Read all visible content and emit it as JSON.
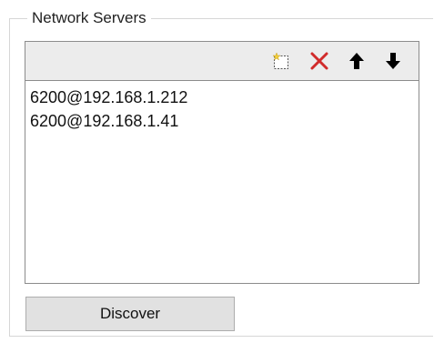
{
  "group": {
    "title": "Network Servers"
  },
  "toolbar": {
    "buttons": [
      {
        "icon": "new-item-icon",
        "color": "#e8c84a"
      },
      {
        "icon": "delete-icon",
        "color": "#d12b2b"
      },
      {
        "icon": "arrow-up-icon",
        "color": "#000000"
      },
      {
        "icon": "arrow-down-icon",
        "color": "#000000"
      }
    ]
  },
  "servers": {
    "items": [
      "6200@192.168.1.212",
      "6200@192.168.1.41"
    ]
  },
  "actions": {
    "discover_label": "Discover"
  }
}
